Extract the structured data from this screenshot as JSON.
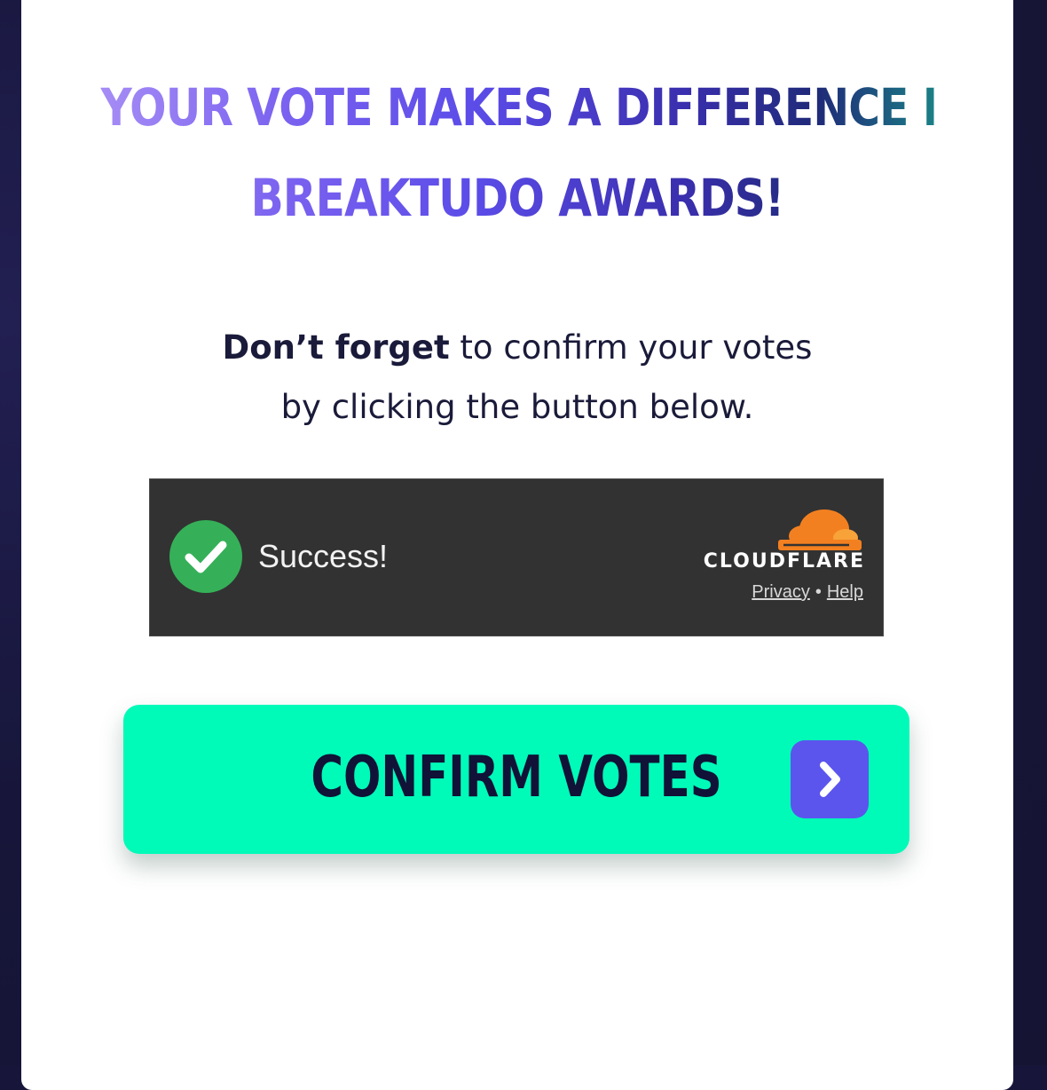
{
  "headline": {
    "line1": "YOUR VOTE MAKES A DIFFERENCE IN THE",
    "line2": "BREAKTUDO AWARDS!"
  },
  "instructions": {
    "bold": "Don’t forget",
    "line1_rest": " to confirm your votes",
    "line2": "by clicking the button below."
  },
  "turnstile": {
    "status": "Success!",
    "brand": "CLOUDFLARE",
    "privacy_link": "Privacy",
    "separator": "•",
    "help_link": "Help",
    "icons": [
      "check-circle-icon",
      "cloudflare-logo-icon"
    ]
  },
  "confirm_button": {
    "label": "CONFIRM VOTES",
    "icon": "chevron-right-icon"
  },
  "colors": {
    "page_background": "#17163a",
    "button_accent": "#00fbb9",
    "arrow_box": "#5b55ee",
    "success_green": "#35b058",
    "cloudflare_orange": "#f38020"
  }
}
